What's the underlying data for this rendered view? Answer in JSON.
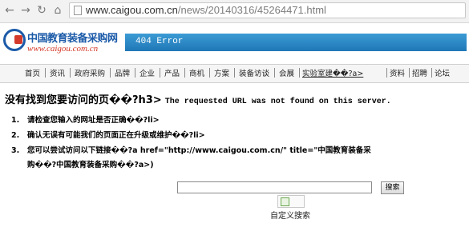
{
  "browser": {
    "back_glyph": "←",
    "forward_glyph": "→",
    "reload_glyph": "↻",
    "home_glyph": "⌂",
    "url_host": "www.caigou.com.cn",
    "url_path": "/news/20140316/45264471.html"
  },
  "site": {
    "logo_cn": "中国教育装备采购网",
    "logo_en": "www.caigou.com.cn",
    "error_label": "404 Error",
    "brand_blue": "#1b5aa8",
    "brand_red": "#d43a2a",
    "bar_blue": "#2e88c6"
  },
  "nav": [
    "首页",
    "资讯",
    "政府采购",
    "品牌",
    "企业",
    "产品",
    "商机",
    "方案",
    "装备访谈",
    "会展",
    "实验室建��?a>",
    "资料",
    "招聘",
    "论坛"
  ],
  "content": {
    "heading_cn": "没有找到您要访问的页��?h3>",
    "heading_en": "The requested URL was not found on this server.",
    "items": [
      {
        "num": "1.",
        "text": "请检查您输入的网址是否正确��?li>"
      },
      {
        "num": "2.",
        "text": "确认无误有可能我们的页面正在升级或维护��?li>"
      },
      {
        "num": "3.",
        "text_a": "您可以尝试访问以下链接��?a href=\"http://www.caigou.com.cn/\" title=\"中国教育装备采",
        "text_b": "购��?中国教育装备采购��?a>)"
      }
    ]
  },
  "search": {
    "input_value": "",
    "button_label": "搜索",
    "custom_label": "自定义搜索"
  }
}
